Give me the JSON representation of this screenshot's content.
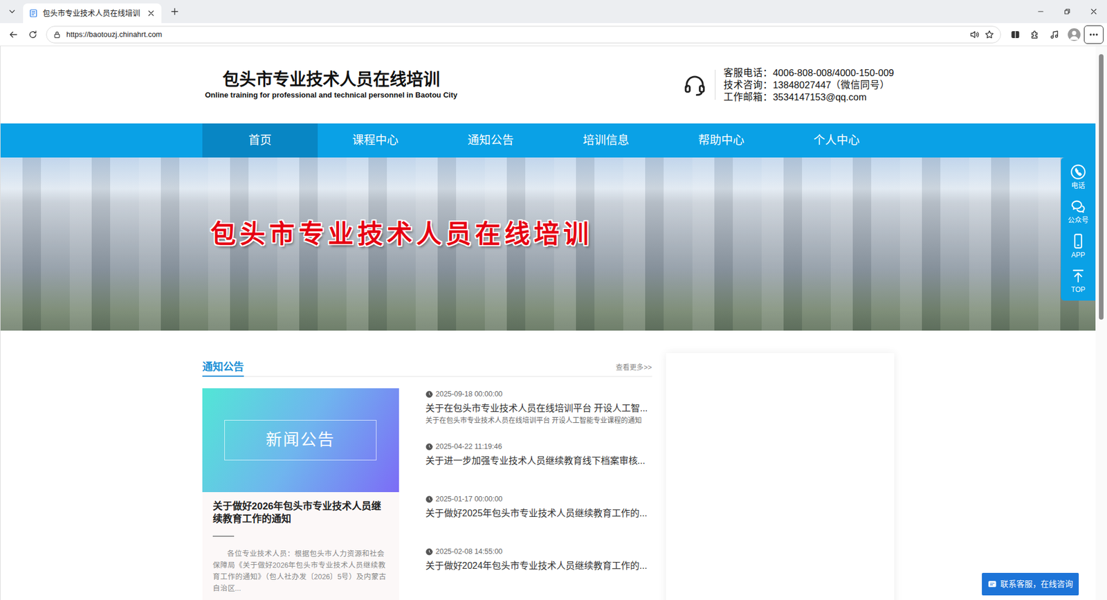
{
  "tabs": [
    {
      "label": "包头市专业技术人员在线培训",
      "selected": true
    }
  ],
  "address_bar": {
    "url": "https://baotouzj.chinahrt.com"
  },
  "site": {
    "title": "包头市专业技术人员在线培训",
    "subtitle": "Online training for professional and technical personnel in Baotou City",
    "contacts": [
      "客服电话：4006-808-008/4000-150-009",
      "技术咨询：13848027447（微信同号）",
      "工作邮箱：3534147153@qq.com"
    ]
  },
  "nav": [
    {
      "label": "首页",
      "selected": true
    },
    {
      "label": "课程中心",
      "selected": false
    },
    {
      "label": "通知公告",
      "selected": false
    },
    {
      "label": "培训信息",
      "selected": false
    },
    {
      "label": "帮助中心",
      "selected": false
    },
    {
      "label": "个人中心",
      "selected": false
    }
  ],
  "banner": {
    "caption": "包头市专业技术人员在线培训"
  },
  "side_tools": [
    {
      "label": "电话",
      "kind": "phone"
    },
    {
      "label": "公众号",
      "kind": "wechat"
    },
    {
      "label": "APP",
      "kind": "app"
    },
    {
      "label": "TOP",
      "kind": "top"
    }
  ],
  "notices": {
    "heading": "通知公告",
    "more": "查看更多>>",
    "featured": {
      "image_text": "新闻公告",
      "title": "关于做好2026年包头市专业技术人员继续教育工作的通知",
      "excerpt": "各位专业技术人员：根据包头市人力资源和社会保障局《关于做好2026年包头市专业技术人员继续教育工作的通知》（包人社办发〔2026〕5号）及内蒙古自治区..."
    },
    "items": [
      {
        "time": "2025-09-18 00:00:00",
        "title": "关于在包头市专业技术人员在线培训平台 开设人工智...",
        "summary": "关于在包头市专业技术人员在线培训平台 开设人工智能专业课程的通知"
      },
      {
        "time": "2025-04-22 11:19:46",
        "title": "关于进一步加强专业技术人员继续教育线下档案审核..."
      },
      {
        "time": "2025-01-17 00:00:00",
        "title": "关于做好2025年包头市专业技术人员继续教育工作的..."
      },
      {
        "time": "2025-02-08 14:55:00",
        "title": "关于做好2024年包头市专业技术人员继续教育工作的..."
      }
    ]
  },
  "chat_button": "联系客服，在线咨询"
}
